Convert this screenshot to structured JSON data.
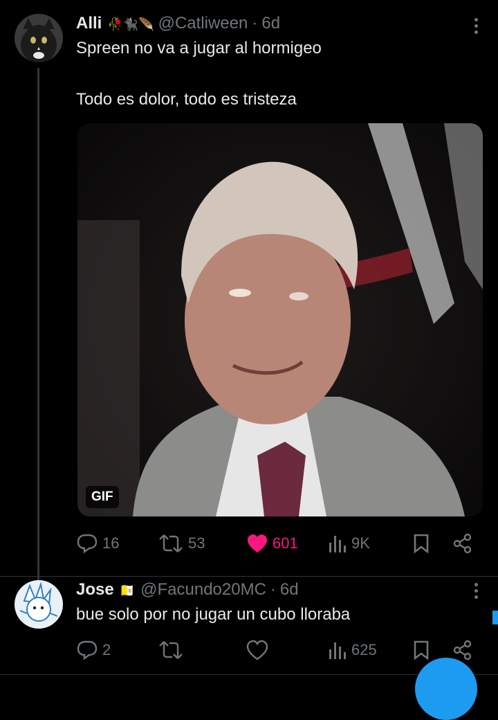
{
  "tweet1": {
    "name": "Alli",
    "emojis": "🥀🐈‍⬛🪶",
    "handle": "@Catliween",
    "dot": "·",
    "time": "6d",
    "text_line1": "Spreen no va a jugar al hormigeo",
    "text_line2": "Todo es dolor, todo es tristeza",
    "media_badge": "GIF",
    "replies": "16",
    "reposts": "53",
    "likes": "601",
    "views": "9K"
  },
  "tweet2": {
    "name": "Jose",
    "emojis": "🇻🇦",
    "handle": "@Facundo20MC",
    "dot": "·",
    "time": "6d",
    "text": "bue solo por no jugar un cubo lloraba",
    "replies": "2",
    "reposts": "",
    "likes": "",
    "views": "625"
  },
  "colors": {
    "background": "#000000",
    "text": "#e7e9ea",
    "secondary": "#71767b",
    "like": "#f91880",
    "accent": "#1d9bf0"
  },
  "icons": [
    "more-icon",
    "reply-icon",
    "repost-icon",
    "like-icon",
    "views-icon",
    "bookmark-icon",
    "share-icon",
    "gif-badge",
    "compose-fab"
  ]
}
